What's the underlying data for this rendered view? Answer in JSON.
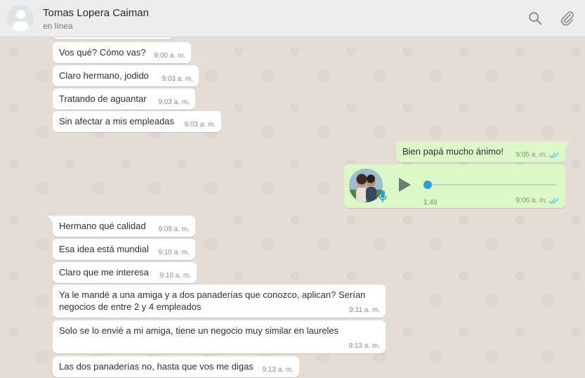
{
  "header": {
    "contact_name": "Tomas Lopera Caiman",
    "contact_status": "en línea",
    "icons": [
      "search-icon",
      "attach-icon"
    ]
  },
  "messages": [
    {
      "direction": "in",
      "text": "Vos qué? Cómo vas?",
      "time": "9:00 a. m."
    },
    {
      "direction": "in",
      "text": "Claro hermano, jodido",
      "time": "9:03 a. m."
    },
    {
      "direction": "in",
      "text": "Tratando de aguantar",
      "time": "9:03 a. m."
    },
    {
      "direction": "in",
      "text": "Sin afectar a mis empleadas",
      "time": "9:03 a. m."
    },
    {
      "direction": "out",
      "text": "Bien papá mucho ánimo!",
      "time": "9:05 a. m.",
      "status": "read"
    },
    {
      "direction": "out",
      "type": "voice",
      "duration": "1:49",
      "time": "9:06 a. m.",
      "status": "read"
    },
    {
      "direction": "in",
      "text": "Hermano qué calidad",
      "time": "9:09 a. m."
    },
    {
      "direction": "in",
      "text": "Esa idea está mundial",
      "time": "9:10 a. m."
    },
    {
      "direction": "in",
      "text": "Claro que me interesa",
      "time": "9:10 a. m."
    },
    {
      "direction": "in",
      "text": "Ya le mandé a una amiga y a dos panaderías que conozco, aplican? Serían negocios de entre 2 y 4 empleados",
      "time": "9:11 a. m."
    },
    {
      "direction": "in",
      "text": "Solo se lo envié a mi amiga, tiene un negocio muy similar en laureles",
      "time": "9:13 a. m."
    },
    {
      "direction": "in",
      "text": "Las dos panaderías no, hasta que vos me digas",
      "time": "9:13 a. m."
    }
  ],
  "colors": {
    "chat_background": "#e5ddd5",
    "outgoing_bubble": "#dcf8c6",
    "incoming_bubble": "#ffffff",
    "read_ticks": "#4fc3f7"
  }
}
